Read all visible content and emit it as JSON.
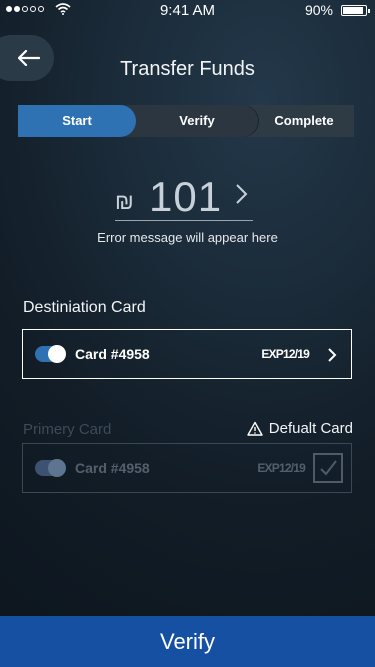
{
  "status_bar": {
    "time": "9:41 AM",
    "battery": "90%"
  },
  "header": {
    "title": "Transfer Funds"
  },
  "steps": [
    "Start",
    "Verify",
    "Complete"
  ],
  "amount": {
    "currency_symbol": "₪",
    "value": "101"
  },
  "error_message": "Error message will appear here",
  "destination": {
    "label": "Destiniation Card",
    "card_name": "Card #4958",
    "expiry": "EXP12/19"
  },
  "primary": {
    "label": "Primery Card",
    "default_label": "Defualt Card",
    "card_name": "Card #4958",
    "expiry": "EXP12/19"
  },
  "verify_button": "Verify",
  "icons": {
    "back": "arrow-left-icon",
    "chevron": "chevron-right-icon",
    "warning": "warning-icon",
    "check": "checkmark-icon",
    "wifi": "wifi-icon",
    "battery": "battery-icon",
    "signal": "signal-dots-icon",
    "toggle": "toggle-icon"
  },
  "colors": {
    "accent": "#2f72b4",
    "verify_bar": "#1550a3",
    "background": "#152330"
  }
}
